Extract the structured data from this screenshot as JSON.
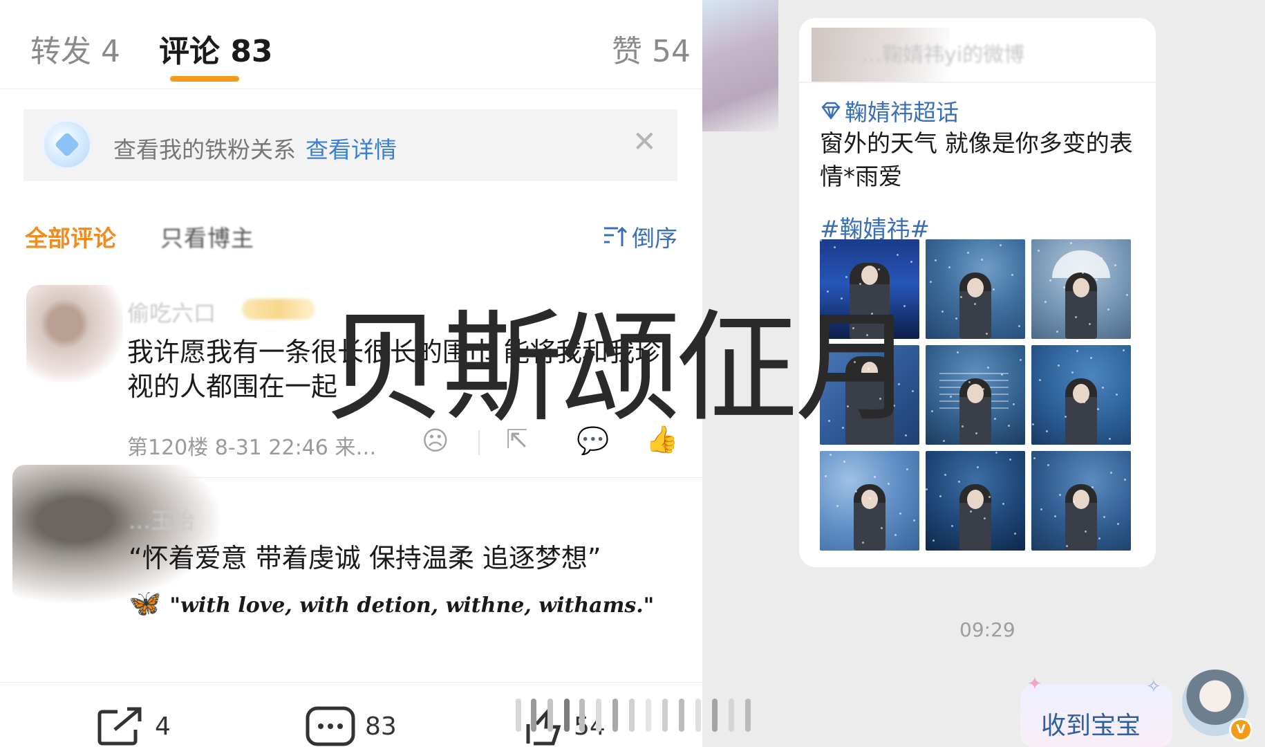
{
  "left": {
    "tabs": {
      "repost": "转发 4",
      "comments": "评论 83",
      "likes": "赞 54"
    },
    "fans_banner": {
      "text": "查看我的铁粉关系",
      "link": "查看详情",
      "close_icon": "close-icon"
    },
    "filters": {
      "all": "全部评论",
      "blogger_only": "只看博主",
      "sort": "倒序",
      "sort_icon": "sort-desc-icon"
    },
    "comments": [
      {
        "username": "偷吃六口",
        "text": "我许愿我有一条很长很长的围巾 能将我和我珍视的人都围在一起",
        "meta": "第120楼  8-31 22:46  来…"
      },
      {
        "username": "…玉怡",
        "text": "“怀着爱意  带着虔诚  保持温柔  追逐梦想”",
        "emoji": "🦋",
        "script_text": "\"with love, with detion, withne, withams.\""
      }
    ],
    "action_bar": {
      "repost_count": "4",
      "comment_count": "83",
      "like_count": "54"
    },
    "colors": {
      "accent": "#f59b1a",
      "link": "#3a7fd5"
    }
  },
  "right": {
    "card": {
      "header": "…鞠婧祎yi的微博",
      "topic": "鞠婧祎超话",
      "post_text": "窗外的天气 就像是你多变的表情*雨爱",
      "hashtag": "#鞠婧祎#"
    },
    "time": "09:29",
    "reply": "收到宝宝"
  },
  "watermark": "贝斯颂佂月"
}
